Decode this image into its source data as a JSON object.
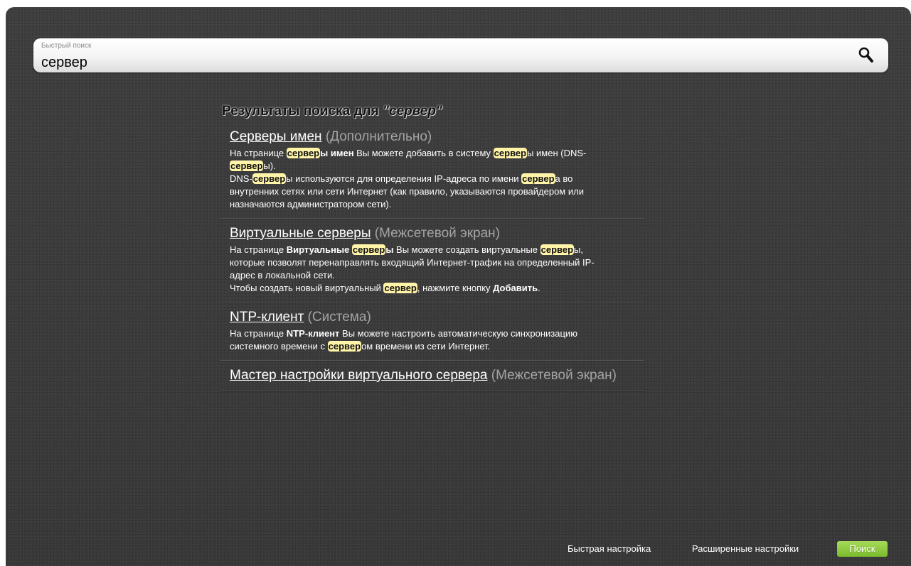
{
  "search": {
    "label": "Быстрый поиск",
    "value": "сервер",
    "icon": "search-icon"
  },
  "results": {
    "title_prefix": "Результаты поиска для ",
    "title_query": "\"сервер\"",
    "items": [
      {
        "title": "Серверы имен",
        "category": "(Дополнительно)",
        "text": [
          [
            "На странице ",
            ""
          ],
          [
            "сервер",
            "hl"
          ],
          [
            "ы имен",
            "b"
          ],
          [
            " Вы можете добавить в систему ",
            ""
          ],
          [
            "сервер",
            "hl"
          ],
          [
            "ы имен (DNS-",
            ""
          ],
          [
            "сервер",
            "hl"
          ],
          [
            "ы).",
            ""
          ],
          [
            "\n",
            "br"
          ],
          [
            "DNS-",
            ""
          ],
          [
            "сервер",
            "hl"
          ],
          [
            "ы используются для определения IP-адреса по имени ",
            ""
          ],
          [
            "сервер",
            "hl"
          ],
          [
            "а во внутренних сетях или сети Интернет (как правило, указываются провайдером или назначаются администратором сети).",
            ""
          ]
        ]
      },
      {
        "title": "Виртуальные серверы",
        "category": "(Межсетевой экран)",
        "text": [
          [
            "На странице ",
            ""
          ],
          [
            "Виртуальные ",
            "b"
          ],
          [
            "сервер",
            "hl"
          ],
          [
            "ы",
            "b"
          ],
          [
            " Вы можете создать виртуальные ",
            ""
          ],
          [
            "сервер",
            "hl"
          ],
          [
            "ы, которые позволят перенаправлять входящий Интернет-трафик на определенный IP-адрес в локальной сети.",
            ""
          ],
          [
            "\n",
            "br"
          ],
          [
            "Чтобы создать новый виртуальный ",
            ""
          ],
          [
            "сервер",
            "hl"
          ],
          [
            ", нажмите кнопку ",
            ""
          ],
          [
            "Добавить",
            "b"
          ],
          [
            ".",
            ""
          ]
        ]
      },
      {
        "title": "NTP-клиент",
        "category": "(Система)",
        "text": [
          [
            "На странице ",
            ""
          ],
          [
            "NTP-клиент",
            "b"
          ],
          [
            " Вы можете настроить автоматическую синхронизацию системного времени с ",
            ""
          ],
          [
            "сервер",
            "hl"
          ],
          [
            "ом времени из сети Интернет.",
            ""
          ]
        ]
      },
      {
        "title": "Мастер настройки виртуального сервера",
        "category": "(Межсетевой экран)",
        "text": []
      }
    ]
  },
  "footer": {
    "quick_setup": "Быстрая настройка",
    "advanced_settings": "Расширенные настройки",
    "search_button": "Поиск"
  },
  "colors": {
    "highlight": "#fff4a8",
    "accent_green": "#8cc63f",
    "background": "#3a3a3a"
  }
}
